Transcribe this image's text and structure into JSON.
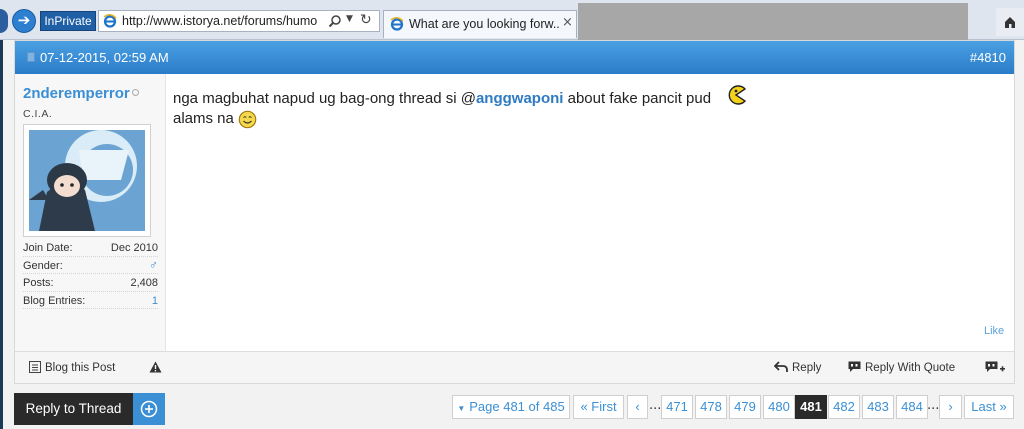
{
  "browser": {
    "inprivate_label": "InPrivate",
    "url": "http://www.istorya.net/forums/humo",
    "tab_title": "What are you looking forw...",
    "tab_close": "×"
  },
  "post": {
    "date": "07-12-2015, 02:59 AM",
    "number": "#4810",
    "user": {
      "name": "2nderemperror",
      "title": "C.I.A.",
      "stats": [
        {
          "label": "Join Date:",
          "value": "Dec 2010"
        },
        {
          "label": "Gender:",
          "value": "♂"
        },
        {
          "label": "Posts:",
          "value": "2,408"
        },
        {
          "label": "Blog Entries:",
          "value": "1"
        }
      ]
    },
    "content": {
      "text_before": "nga magbuhat napud ug bag-ong thread si @",
      "mention": "anggwaponi",
      "text_after": " about fake pancit pud",
      "line2": "alams na"
    },
    "like_label": "Like",
    "footer": {
      "blog_this_post": "Blog this Post",
      "reply": "Reply",
      "reply_with_quote": "Reply With Quote"
    }
  },
  "reply_to_thread_label": "Reply to Thread",
  "pagination": {
    "page_info": "Page 481 of 485",
    "first_label": "« First",
    "prev_label": "‹",
    "next_label": "›",
    "last_label": "Last »",
    "dots": "...",
    "pages": [
      "471",
      "478",
      "479",
      "480",
      "481",
      "482",
      "483",
      "484"
    ],
    "current_page": "481"
  },
  "colors": {
    "accent": "#3b8fd4",
    "header_blue": "#2b7cc8",
    "dark_button": "#2a2a2a"
  }
}
